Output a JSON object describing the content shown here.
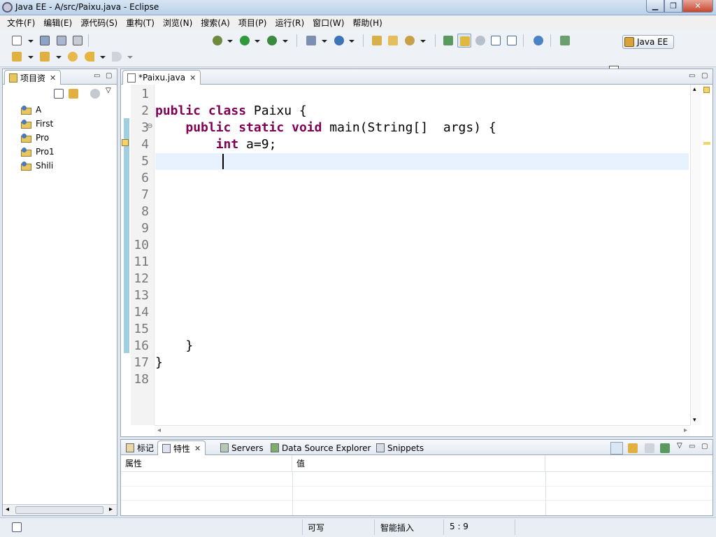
{
  "window": {
    "title": "Java EE  -  A/src/Paixu.java  -  Eclipse",
    "min_glyph": "▁",
    "max_glyph": "❐",
    "close_glyph": "✕"
  },
  "menu": [
    "文件(F)",
    "编辑(E)",
    "源代码(S)",
    "重构(T)",
    "浏览(N)",
    "搜索(A)",
    "项目(P)",
    "运行(R)",
    "窗口(W)",
    "帮助(H)"
  ],
  "perspective": {
    "label": "Java EE"
  },
  "explorer": {
    "tab_label": "项目资",
    "close_glyph": "✕",
    "projects": [
      "A",
      "First",
      "Pro",
      "Pro1",
      "Shili"
    ]
  },
  "editor": {
    "tab_label": "*Paixu.java",
    "close_glyph": "✕",
    "line_numbers": [
      "1",
      "2",
      "3",
      "4",
      "5",
      "6",
      "7",
      "8",
      "9",
      "10",
      "11",
      "12",
      "13",
      "14",
      "15",
      "16",
      "17",
      "18"
    ],
    "lines": [
      [],
      [
        {
          "t": "public",
          "k": true
        },
        {
          "t": " "
        },
        {
          "t": "class",
          "k": true
        },
        {
          "t": " Paixu {"
        }
      ],
      [
        {
          "t": "    "
        },
        {
          "t": "public",
          "k": true
        },
        {
          "t": " "
        },
        {
          "t": "static",
          "k": true
        },
        {
          "t": " "
        },
        {
          "t": "void",
          "k": true
        },
        {
          "t": " main(String[]  args) {"
        }
      ],
      [
        {
          "t": "        "
        },
        {
          "t": "int",
          "k": true
        },
        {
          "t": " a=9;"
        }
      ],
      [],
      [],
      [],
      [],
      [],
      [],
      [],
      [],
      [],
      [],
      [],
      [
        {
          "t": "    }"
        }
      ],
      [
        {
          "t": "}"
        }
      ],
      []
    ],
    "cursor_line": 5,
    "cursor_col": 9
  },
  "bottom_tabs": [
    "标记",
    "特性",
    "Servers",
    "Data Source Explorer",
    "Snippets"
  ],
  "properties": {
    "headers": [
      "属性",
      "值"
    ]
  },
  "status": {
    "writable": "可写",
    "insert_mode": "智能插入",
    "position": "5 : 9"
  },
  "colors": {
    "keyword": "#7f0055",
    "current_line": "#e8f2fe",
    "change_bar": "#9fcfe0"
  }
}
